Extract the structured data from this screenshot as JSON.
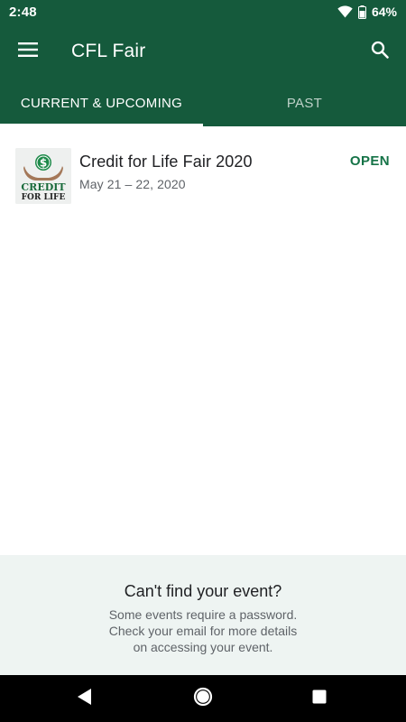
{
  "status_bar": {
    "time": "2:48",
    "battery": "64%"
  },
  "app_bar": {
    "title": "CFL Fair",
    "menu_icon": "hamburger-menu-icon",
    "search_icon": "search-icon"
  },
  "tabs": [
    {
      "label": "CURRENT & UPCOMING",
      "active": true
    },
    {
      "label": "PAST",
      "active": false
    }
  ],
  "events": [
    {
      "name": "Credit for Life Fair 2020",
      "dates": "May 21 – 22, 2020",
      "status": "OPEN",
      "logo": {
        "line1": "CREDIT",
        "line2": "FOR LIFE",
        "symbol": "$"
      }
    }
  ],
  "help": {
    "title": "Can't find your event?",
    "lines": [
      "Some events require a password.",
      "Check your email for more details",
      "on accessing your event."
    ]
  },
  "colors": {
    "primary": "#155a3c",
    "accent": "#157347",
    "help_bg": "#eef4f2"
  }
}
